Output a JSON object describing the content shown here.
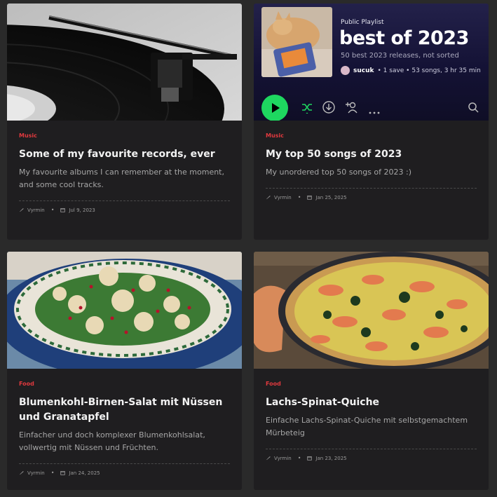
{
  "cards": [
    {
      "category": "Music",
      "title": "Some of my favourite records, ever",
      "excerpt": "My favourite albums I can remember at the moment, and some cool tracks.",
      "author": "Vyrmin",
      "date": "Jul 9, 2023",
      "image": "turntable-photo"
    },
    {
      "category": "Music",
      "title": "My top 50 songs of 2023",
      "excerpt": "My unordered top 50 songs of 2023 :)",
      "author": "Vyrmin",
      "date": "Jan 25, 2025",
      "image": "spotify-playlist-screenshot",
      "playlist": {
        "label": "Public Playlist",
        "name": "best of 2023",
        "description": "50 best 2023 releases, not sorted",
        "owner": "sucuk",
        "stats": "• 1 save • 53 songs, 3 hr 35 min"
      }
    },
    {
      "category": "Food",
      "title": "Blumenkohl-Birnen-Salat mit Nüssen und Granatapfel",
      "excerpt": "Einfacher und doch komplexer Blumenkohlsalat, vollwertig mit Nüssen und Früchten.",
      "author": "Vyrmin",
      "date": "Jan 24, 2025",
      "image": "cauliflower-salad-photo"
    },
    {
      "category": "Food",
      "title": "Lachs-Spinat-Quiche",
      "excerpt": "Einfache Lachs-Spinat-Quiche mit selbstgemachtem Mürbeteig",
      "author": "Vyrmin",
      "date": "Jan 23, 2025",
      "image": "salmon-quiche-photo"
    }
  ],
  "colors": {
    "page_bg": "#2a2a2a",
    "card_bg": "#1f1e20",
    "category": "#e0393e",
    "title": "#f2f2f2",
    "excerpt": "#a6a6a6",
    "spotify_green": "#1ed760"
  },
  "meta_icons": [
    "feather-icon",
    "calendar-icon"
  ],
  "separator": "•"
}
